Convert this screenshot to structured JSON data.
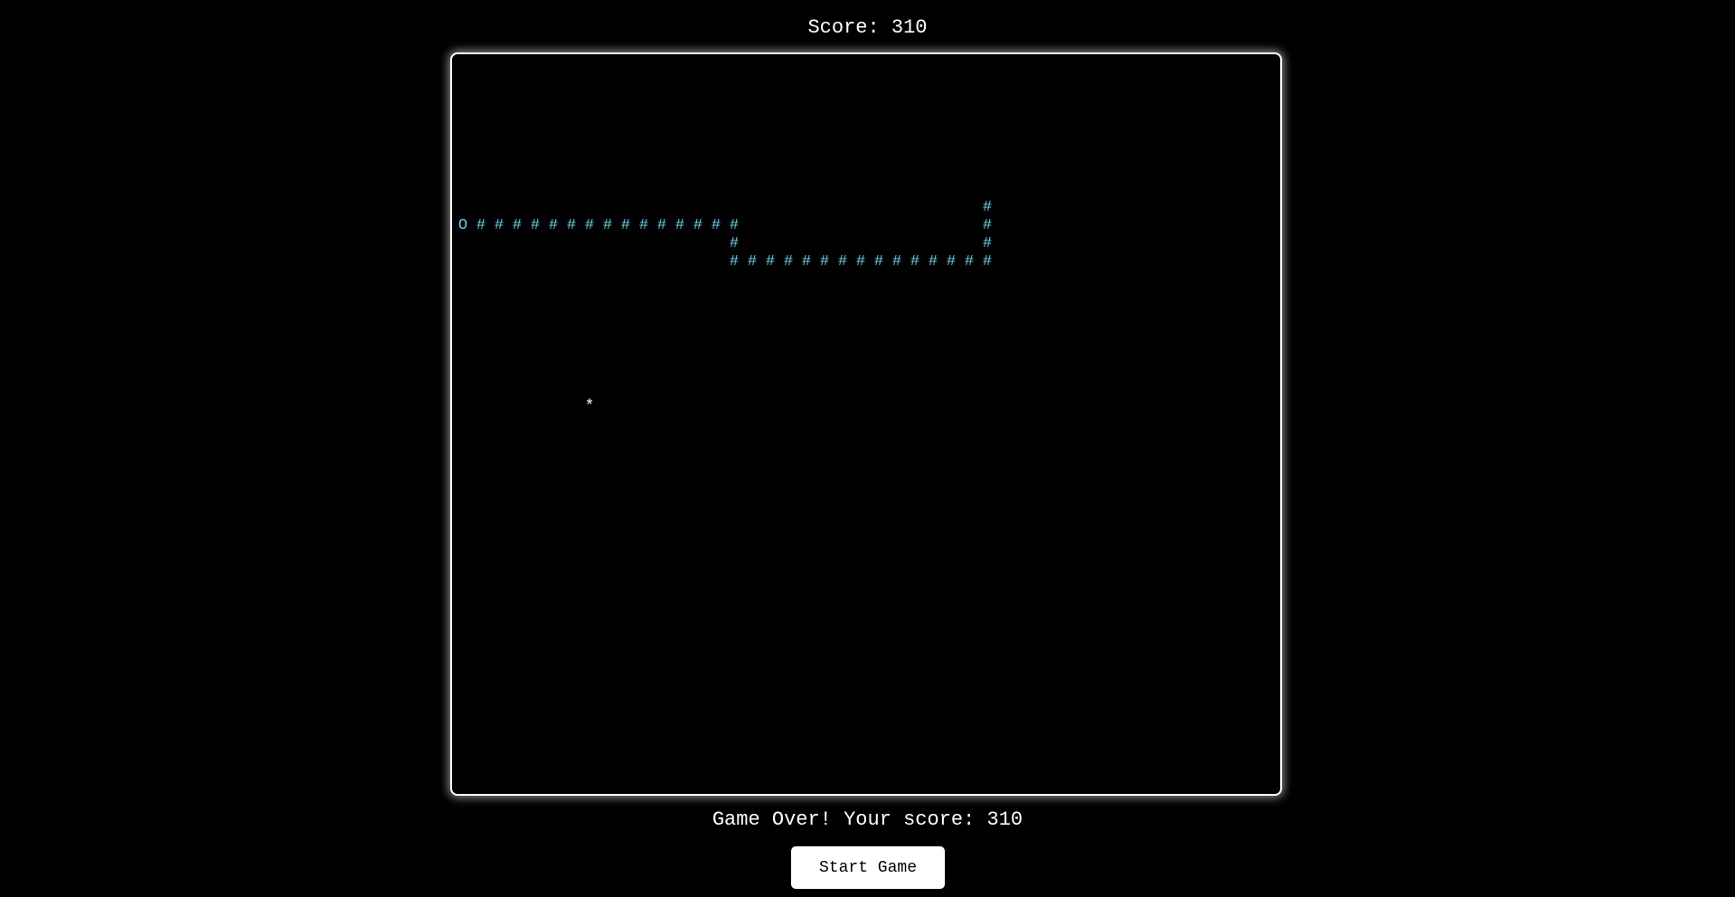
{
  "score_text": "Score: 310",
  "game_over_text": "Game Over! Your score: 310",
  "start_button_label": "Start Game",
  "colors": {
    "background": "#000000",
    "snake": "#5fd7e6",
    "food": "#ffffff",
    "border": "#ffffff"
  },
  "glyphs": {
    "head": "O",
    "body": "#",
    "food": "*"
  },
  "snake": {
    "head": [
      0,
      9
    ],
    "body": [
      [
        1,
        9
      ],
      [
        2,
        9
      ],
      [
        3,
        9
      ],
      [
        4,
        9
      ],
      [
        5,
        9
      ],
      [
        6,
        9
      ],
      [
        7,
        9
      ],
      [
        8,
        9
      ],
      [
        9,
        9
      ],
      [
        10,
        9
      ],
      [
        11,
        9
      ],
      [
        12,
        9
      ],
      [
        13,
        9
      ],
      [
        14,
        9
      ],
      [
        15,
        9
      ],
      [
        15,
        10
      ],
      [
        15,
        11
      ],
      [
        16,
        11
      ],
      [
        17,
        11
      ],
      [
        18,
        11
      ],
      [
        19,
        11
      ],
      [
        20,
        11
      ],
      [
        21,
        11
      ],
      [
        22,
        11
      ],
      [
        23,
        11
      ],
      [
        24,
        11
      ],
      [
        25,
        11
      ],
      [
        26,
        11
      ],
      [
        27,
        11
      ],
      [
        28,
        11
      ],
      [
        29,
        11
      ],
      [
        29,
        10
      ],
      [
        29,
        9
      ],
      [
        29,
        8
      ]
    ]
  },
  "food": [
    7,
    19
  ]
}
